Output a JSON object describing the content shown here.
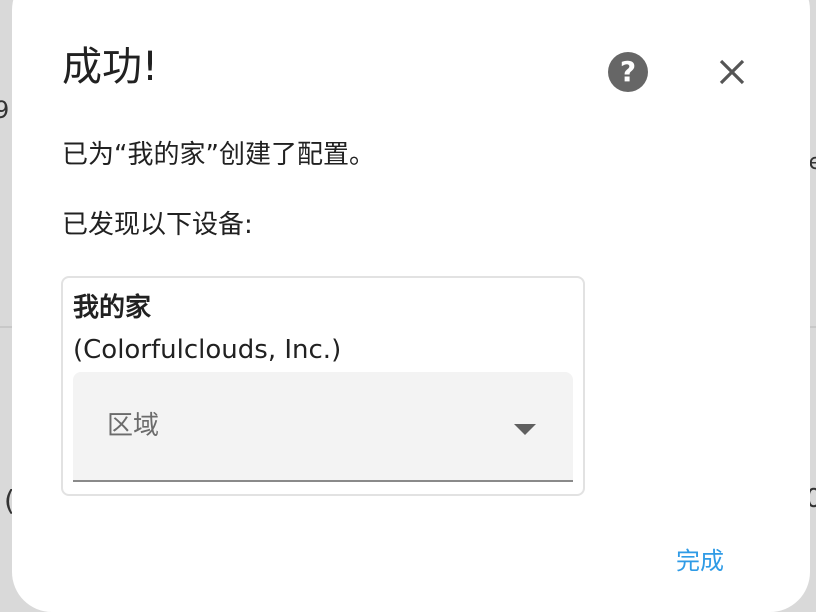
{
  "background": {
    "left_fragment_top": "9",
    "left_fragment_bottom": "(",
    "right_fragment_top": "e",
    "right_fragment_bottom": "0"
  },
  "dialog": {
    "title": "成功!",
    "help_icon": "question-mark-icon",
    "close_icon": "close-icon",
    "message_1": "已为“我的家”创建了配置。",
    "message_2": "已发现以下设备:",
    "device": {
      "name": "我的家",
      "manufacturer": "(Colorfulclouds, Inc.)",
      "area_label": "区域"
    },
    "done_button": "完成"
  },
  "colors": {
    "accent": "#2f9be6",
    "help_bg": "#666666",
    "card_border": "#e2e2e2",
    "select_bg": "#f3f3f3"
  }
}
